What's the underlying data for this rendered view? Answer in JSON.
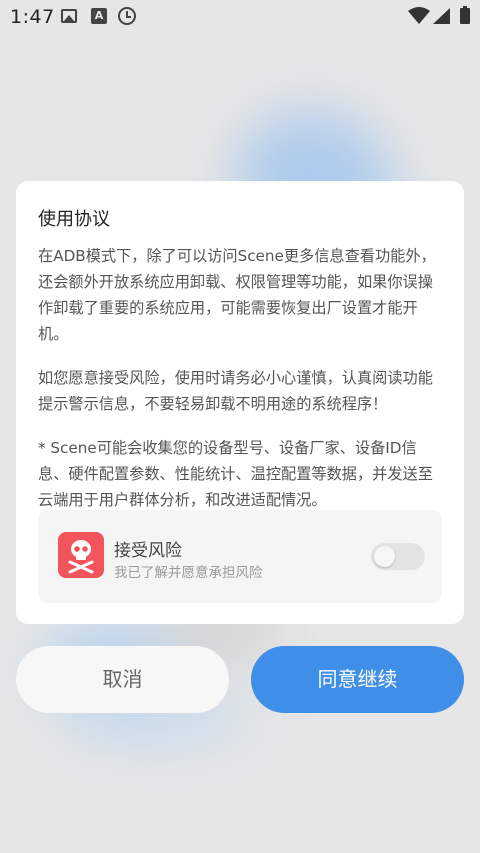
{
  "status_bar": {
    "time": "1:47",
    "icons": [
      "image-icon",
      "a-icon",
      "clock-icon",
      "wifi-icon",
      "signal-icon",
      "battery-icon"
    ],
    "a_label": "A"
  },
  "dialog": {
    "title": "使用协议",
    "paragraphs": [
      "在ADB模式下，除了可以访问Scene更多信息查看功能外，还会额外开放系统应用卸载、权限管理等功能，如果你误操作卸载了重要的系统应用，可能需要恢复出厂设置才能开机。",
      "如您愿意接受风险，使用时请务必小心谨慎，认真阅读功能提示警示信息，不要轻易卸载不明用途的系统程序！",
      "* Scene可能会收集您的设备型号、设备厂家、设备ID信息、硬件配置参数、性能统计、温控配置等数据，并发送至云端用于用户群体分析，和改进适配情况。"
    ],
    "risk": {
      "icon": "skull-crossbones-icon",
      "title": "接受风险",
      "subtitle": "我已了解并愿意承担风险",
      "toggle_on": false
    }
  },
  "buttons": {
    "cancel": "取消",
    "agree": "同意继续"
  },
  "colors": {
    "accent": "#3f8ee7",
    "danger": "#f2545b"
  }
}
